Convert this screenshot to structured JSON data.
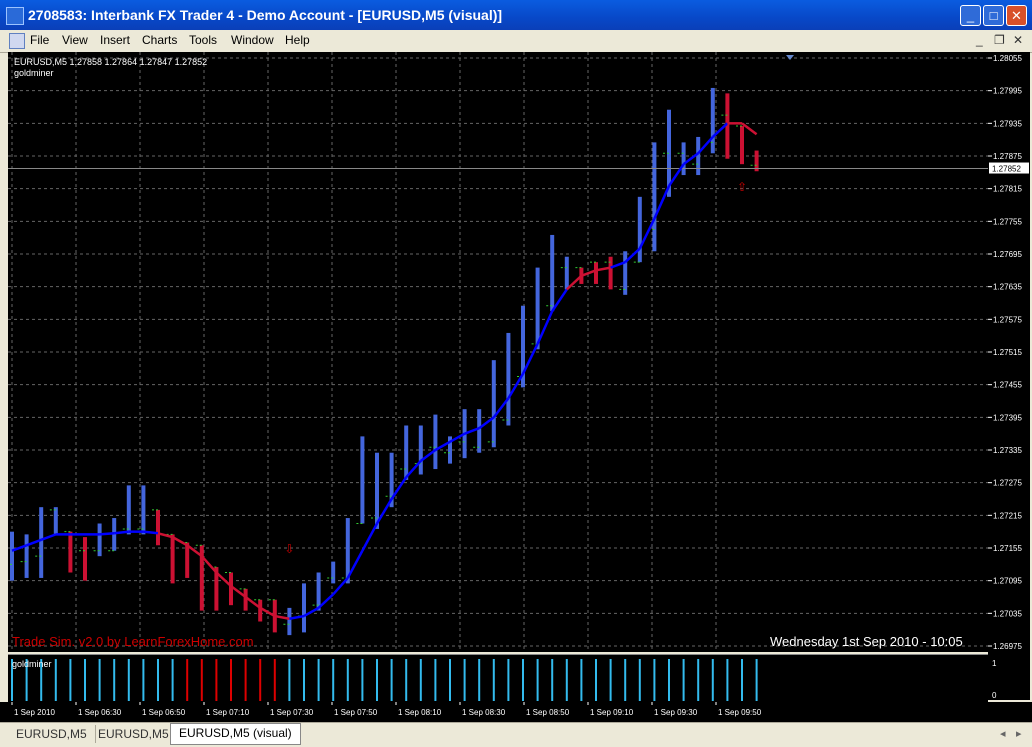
{
  "window": {
    "title": "2708583: Interbank FX Trader 4 - Demo Account - [EURUSD,M5 (visual)]"
  },
  "menu": [
    "File",
    "View",
    "Insert",
    "Charts",
    "Tools",
    "Window",
    "Help"
  ],
  "chart": {
    "info": "EURUSD,M5  1.27858 1.27864 1.27847 1.27852",
    "indicator_name": "goldminer",
    "watermark": "Trade Sim. v2.0 by LearnForexHome.com",
    "datetime": "Wednesday 1st Sep 2010 - 10:05",
    "current_price": "1.27852",
    "price_labels": [
      "1.28055",
      "1.27995",
      "1.27935",
      "1.27875",
      "1.27815",
      "1.27755",
      "1.27695",
      "1.27635",
      "1.27575",
      "1.27515",
      "1.27455",
      "1.27395",
      "1.27335",
      "1.27275",
      "1.27215",
      "1.27155",
      "1.27095",
      "1.27035",
      "1.26975"
    ],
    "time_labels": [
      "1 Sep 2010",
      "1 Sep 06:30",
      "1 Sep 06:50",
      "1 Sep 07:10",
      "1 Sep 07:30",
      "1 Sep 07:50",
      "1 Sep 08:10",
      "1 Sep 08:30",
      "1 Sep 08:50",
      "1 Sep 09:10",
      "1 Sep 09:30",
      "1 Sep 09:50"
    ],
    "indicator_panel": {
      "name": "goldminer",
      "scale_labels": [
        "1",
        "0"
      ]
    },
    "colors": {
      "bull": "#4466dd",
      "bear": "#cc1133",
      "ma": "#0000ff",
      "ma_bear": "#cc1133",
      "grid": "#666666",
      "text": "#ffffff",
      "watermark": "#cc0000",
      "ind_bull": "#33bbee",
      "ind_bear": "#dd0000",
      "arrow": "#cc0000"
    }
  },
  "chart_data": {
    "type": "line",
    "symbol": "EURUSD",
    "timeframe": "M5",
    "ylim": [
      1.26975,
      1.28055
    ],
    "bars": [
      {
        "o": 1.27125,
        "h": 1.27185,
        "l": 1.27095,
        "c": 1.2717,
        "dir": "up"
      },
      {
        "o": 1.2713,
        "h": 1.2718,
        "l": 1.271,
        "c": 1.2717,
        "dir": "up"
      },
      {
        "o": 1.2714,
        "h": 1.2723,
        "l": 1.271,
        "c": 1.2722,
        "dir": "up"
      },
      {
        "o": 1.27225,
        "h": 1.2723,
        "l": 1.2718,
        "c": 1.2719,
        "dir": "up"
      },
      {
        "o": 1.27185,
        "h": 1.27185,
        "l": 1.2711,
        "c": 1.2712,
        "dir": "down"
      },
      {
        "o": 1.2715,
        "h": 1.27175,
        "l": 1.27095,
        "c": 1.27105,
        "dir": "down"
      },
      {
        "o": 1.2715,
        "h": 1.272,
        "l": 1.2714,
        "c": 1.27175,
        "dir": "up"
      },
      {
        "o": 1.2715,
        "h": 1.2721,
        "l": 1.2715,
        "c": 1.27195,
        "dir": "up"
      },
      {
        "o": 1.2719,
        "h": 1.2727,
        "l": 1.2718,
        "c": 1.2719,
        "dir": "up"
      },
      {
        "o": 1.2719,
        "h": 1.2727,
        "l": 1.2718,
        "c": 1.27185,
        "dir": "up"
      },
      {
        "o": 1.27225,
        "h": 1.27225,
        "l": 1.2716,
        "c": 1.27175,
        "dir": "down"
      },
      {
        "o": 1.2718,
        "h": 1.2718,
        "l": 1.2709,
        "c": 1.271,
        "dir": "down"
      },
      {
        "o": 1.27165,
        "h": 1.27165,
        "l": 1.271,
        "c": 1.2711,
        "dir": "down"
      },
      {
        "o": 1.2716,
        "h": 1.2716,
        "l": 1.2704,
        "c": 1.27045,
        "dir": "down"
      },
      {
        "o": 1.2712,
        "h": 1.2712,
        "l": 1.2704,
        "c": 1.2705,
        "dir": "down"
      },
      {
        "o": 1.2711,
        "h": 1.2711,
        "l": 1.2705,
        "c": 1.2706,
        "dir": "down"
      },
      {
        "o": 1.2708,
        "h": 1.2708,
        "l": 1.2704,
        "c": 1.2705,
        "dir": "down"
      },
      {
        "o": 1.2706,
        "h": 1.2706,
        "l": 1.2702,
        "c": 1.2703,
        "dir": "down"
      },
      {
        "o": 1.2706,
        "h": 1.2706,
        "l": 1.27,
        "c": 1.27005,
        "dir": "down"
      },
      {
        "o": 1.27015,
        "h": 1.27045,
        "l": 1.26995,
        "c": 1.27045,
        "dir": "up"
      },
      {
        "o": 1.2703,
        "h": 1.2709,
        "l": 1.27,
        "c": 1.27085,
        "dir": "up"
      },
      {
        "o": 1.2705,
        "h": 1.2711,
        "l": 1.2704,
        "c": 1.2709,
        "dir": "up"
      },
      {
        "o": 1.271,
        "h": 1.2713,
        "l": 1.2709,
        "c": 1.2711,
        "dir": "up"
      },
      {
        "o": 1.271,
        "h": 1.2721,
        "l": 1.2709,
        "c": 1.272,
        "dir": "up"
      },
      {
        "o": 1.272,
        "h": 1.2736,
        "l": 1.272,
        "c": 1.2734,
        "dir": "up"
      },
      {
        "o": 1.2721,
        "h": 1.2733,
        "l": 1.2719,
        "c": 1.2728,
        "dir": "up"
      },
      {
        "o": 1.2725,
        "h": 1.2733,
        "l": 1.2723,
        "c": 1.273,
        "dir": "up"
      },
      {
        "o": 1.273,
        "h": 1.2738,
        "l": 1.2728,
        "c": 1.2733,
        "dir": "up"
      },
      {
        "o": 1.2731,
        "h": 1.2738,
        "l": 1.2729,
        "c": 1.2733,
        "dir": "up"
      },
      {
        "o": 1.2734,
        "h": 1.274,
        "l": 1.273,
        "c": 1.2736,
        "dir": "up"
      },
      {
        "o": 1.2733,
        "h": 1.2736,
        "l": 1.2731,
        "c": 1.2734,
        "dir": "up"
      },
      {
        "o": 1.2735,
        "h": 1.2741,
        "l": 1.2732,
        "c": 1.2736,
        "dir": "up"
      },
      {
        "o": 1.2734,
        "h": 1.2741,
        "l": 1.2733,
        "c": 1.2735,
        "dir": "up"
      },
      {
        "o": 1.2735,
        "h": 1.275,
        "l": 1.2734,
        "c": 1.2749,
        "dir": "up"
      },
      {
        "o": 1.2739,
        "h": 1.2755,
        "l": 1.2738,
        "c": 1.2747,
        "dir": "up"
      },
      {
        "o": 1.2747,
        "h": 1.276,
        "l": 1.2745,
        "c": 1.2756,
        "dir": "up"
      },
      {
        "o": 1.2753,
        "h": 1.2767,
        "l": 1.2752,
        "c": 1.276,
        "dir": "up"
      },
      {
        "o": 1.276,
        "h": 1.2773,
        "l": 1.2759,
        "c": 1.2766,
        "dir": "up"
      },
      {
        "o": 1.2767,
        "h": 1.2769,
        "l": 1.2763,
        "c": 1.2765,
        "dir": "up"
      },
      {
        "o": 1.2767,
        "h": 1.2767,
        "l": 1.2764,
        "c": 1.2765,
        "dir": "down"
      },
      {
        "o": 1.2768,
        "h": 1.2768,
        "l": 1.2764,
        "c": 1.2765,
        "dir": "down"
      },
      {
        "o": 1.2768,
        "h": 1.2769,
        "l": 1.2763,
        "c": 1.2764,
        "dir": "down"
      },
      {
        "o": 1.2763,
        "h": 1.277,
        "l": 1.2762,
        "c": 1.2768,
        "dir": "up"
      },
      {
        "o": 1.2768,
        "h": 1.278,
        "l": 1.2768,
        "c": 1.2778,
        "dir": "up"
      },
      {
        "o": 1.2774,
        "h": 1.279,
        "l": 1.277,
        "c": 1.279,
        "dir": "up"
      },
      {
        "o": 1.2788,
        "h": 1.2796,
        "l": 1.278,
        "c": 1.279,
        "dir": "up"
      },
      {
        "o": 1.2788,
        "h": 1.279,
        "l": 1.2784,
        "c": 1.2789,
        "dir": "up"
      },
      {
        "o": 1.2786,
        "h": 1.2791,
        "l": 1.2784,
        "c": 1.2788,
        "dir": "up"
      },
      {
        "o": 1.279,
        "h": 1.28,
        "l": 1.2788,
        "c": 1.2793,
        "dir": "up"
      },
      {
        "o": 1.2795,
        "h": 1.2799,
        "l": 1.2787,
        "c": 1.2788,
        "dir": "down"
      },
      {
        "o": 1.2793,
        "h": 1.2793,
        "l": 1.2786,
        "c": 1.2787,
        "dir": "down"
      },
      {
        "o": 1.27858,
        "h": 1.27885,
        "l": 1.27847,
        "c": 1.27852,
        "dir": "down"
      }
    ],
    "moving_average": [
      1.2715,
      1.2716,
      1.2717,
      1.2718,
      1.2718,
      1.2718,
      1.2718,
      1.27182,
      1.27185,
      1.27185,
      1.27182,
      1.27175,
      1.2716,
      1.2714,
      1.2711,
      1.27085,
      1.27065,
      1.27045,
      1.2703,
      1.27025,
      1.2703,
      1.27045,
      1.2707,
      1.271,
      1.2715,
      1.272,
      1.27245,
      1.27285,
      1.27315,
      1.27335,
      1.2735,
      1.27365,
      1.27375,
      1.27395,
      1.2743,
      1.27475,
      1.2753,
      1.2759,
      1.2763,
      1.27655,
      1.27665,
      1.2767,
      1.2768,
      1.27705,
      1.2776,
      1.2782,
      1.2786,
      1.2788,
      1.2791,
      1.27935,
      1.27935,
      1.27915
    ],
    "indicator_signals": [
      1,
      1,
      1,
      1,
      1,
      1,
      1,
      1,
      1,
      1,
      1,
      1,
      1,
      1,
      1,
      1,
      1,
      1,
      1,
      1,
      1,
      1,
      1,
      1,
      1,
      1,
      1,
      1,
      1,
      1,
      1,
      1,
      1,
      1,
      1,
      1,
      1,
      1,
      1,
      1,
      1,
      1,
      1,
      1,
      1,
      1,
      1,
      1,
      1,
      1,
      1,
      1
    ],
    "indicator_colors": [
      "bull",
      "bull",
      "bull",
      "bull",
      "bull",
      "bull",
      "bull",
      "bull",
      "bull",
      "bull",
      "bull",
      "bull",
      "bear",
      "bear",
      "bear",
      "bear",
      "bear",
      "bear",
      "bear",
      "bull",
      "bull",
      "bull",
      "bull",
      "bull",
      "bull",
      "bull",
      "bull",
      "bull",
      "bull",
      "bull",
      "bull",
      "bull",
      "bull",
      "bull",
      "bull",
      "bull",
      "bull",
      "bull",
      "bull",
      "bull",
      "bull",
      "bull",
      "bull",
      "bull",
      "bull",
      "bull",
      "bull",
      "bull",
      "bull",
      "bull",
      "bull",
      "bull"
    ],
    "arrows": [
      {
        "bar": 19,
        "price": 1.27155,
        "type": "down"
      },
      {
        "bar": 50,
        "price": 1.2782,
        "type": "up"
      }
    ]
  },
  "tabs": [
    "EURUSD,M5",
    "EURUSD,M5",
    "EURUSD,M5 (visual)"
  ]
}
